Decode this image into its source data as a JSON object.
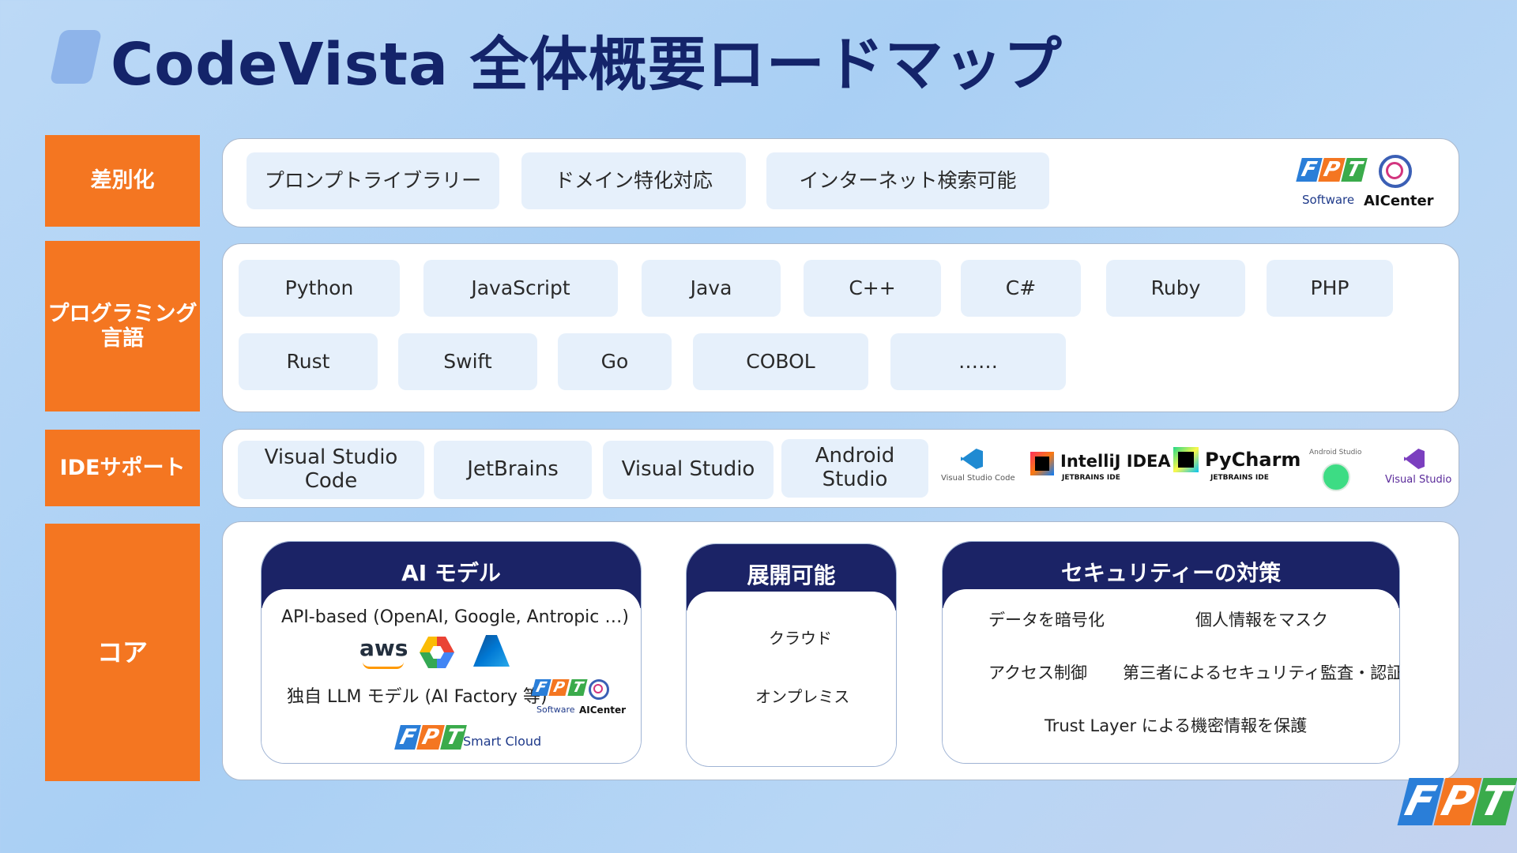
{
  "title": "CodeVista 全体概要ロードマップ",
  "rows": {
    "differentiation": {
      "label": "差別化",
      "chips": [
        "プロンプトライブラリー",
        "ドメイン特化対応",
        "インターネット検索可能"
      ],
      "logos": {
        "software": "Software",
        "aicenter": "AICenter",
        "fpt": "FPT"
      }
    },
    "languages": {
      "label": "プログラミング言語",
      "row1": [
        "Python",
        "JavaScript",
        "Java",
        "C++",
        "C#",
        "Ruby",
        "PHP"
      ],
      "row2": [
        "Rust",
        "Swift",
        "Go",
        "COBOL",
        "……"
      ]
    },
    "ide": {
      "label": "IDEサポート",
      "chips": [
        "Visual Studio Code",
        "JetBrains",
        "Visual Studio",
        "Android Studio"
      ],
      "logos": {
        "vscode": "Visual Studio Code",
        "intellij": "IntelliJ IDEA",
        "intellij_sub": "JETBRAINS IDE",
        "pycharm": "PyCharm",
        "pycharm_sub": "JETBRAINS IDE",
        "android": "Android Studio",
        "vs": "Visual Studio"
      }
    },
    "core": {
      "label": "コア",
      "ai_model": {
        "title": "AI モデル",
        "api": "API-based (OpenAI, Google, Antropic …)",
        "aws": "aws",
        "custom": "独自 LLM モデル (AI Factory 等)",
        "software": "Software",
        "aicenter": "AICenter",
        "smart_cloud": "Smart Cloud"
      },
      "deploy": {
        "title": "展開可能",
        "items": [
          "クラウド",
          "オンプレミス"
        ]
      },
      "security": {
        "title": "セキュリティーの対策",
        "items": [
          "データを暗号化",
          "個人情報をマスク",
          "アクセス制御",
          "第三者によるセキュリティ監査・認証",
          "Trust Layer による機密情報を保護"
        ]
      }
    }
  },
  "footer_logo": "FPT",
  "colors": {
    "navy": "#14246a",
    "orange": "#f47621",
    "chip": "#e6f0fb"
  }
}
